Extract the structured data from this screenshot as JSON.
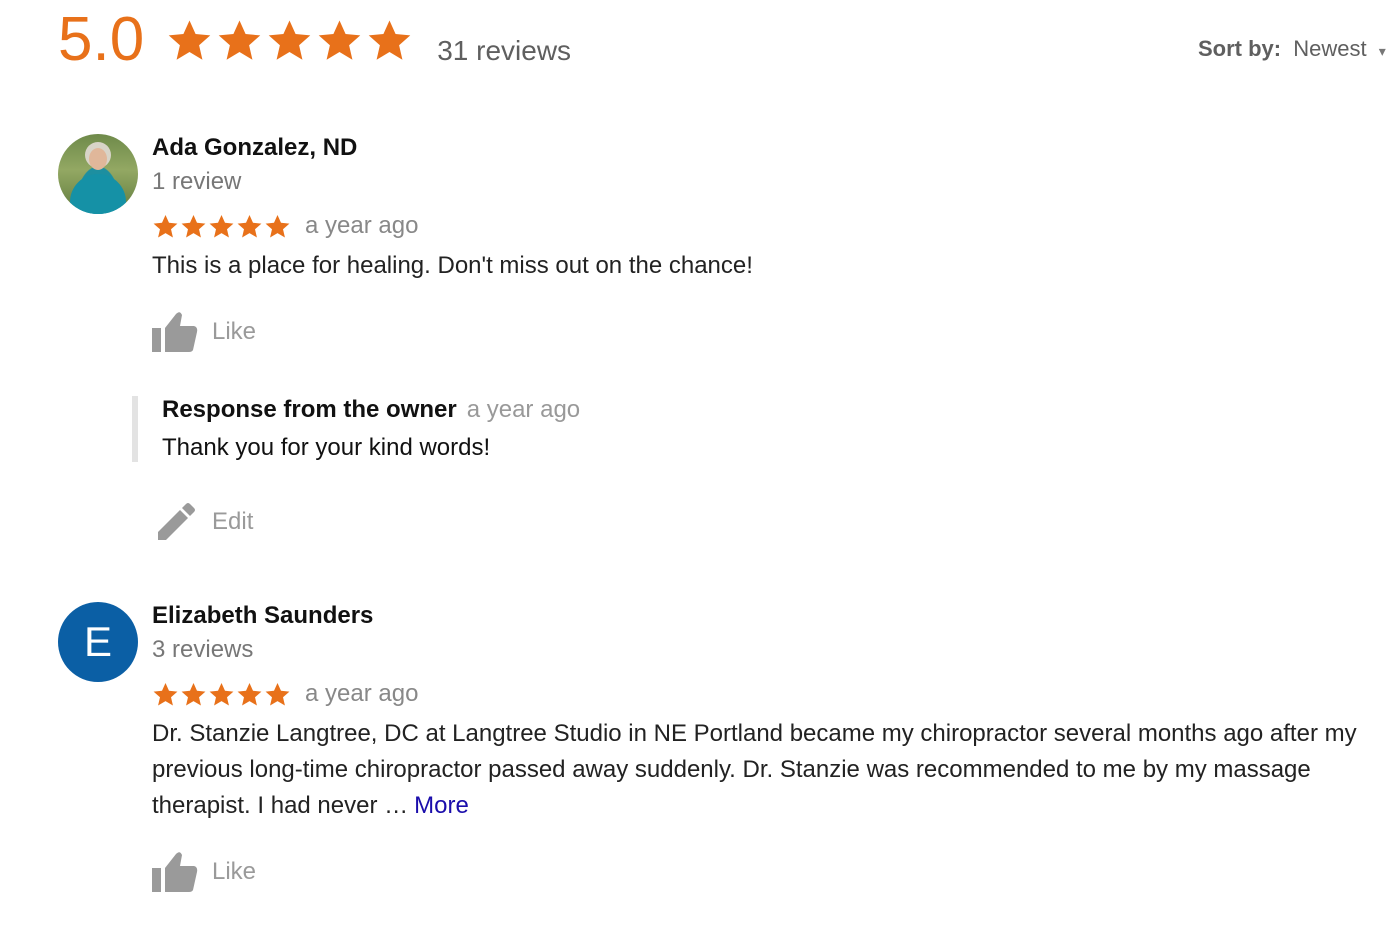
{
  "summary": {
    "score": "5.0",
    "rating": 5,
    "review_count": "31 reviews",
    "star_color": "#e8711a"
  },
  "sort": {
    "label": "Sort by:",
    "value": "Newest"
  },
  "reviews": [
    {
      "name": "Ada Gonzalez, ND",
      "review_count": "1 review",
      "rating": 5,
      "time": "a year ago",
      "text": "This is a place for healing. Don't miss out on the chance!",
      "like_label": "Like",
      "owner_response": {
        "title": "Response from the owner",
        "time": "a year ago",
        "text": "Thank you for your kind words!",
        "edit_label": "Edit"
      }
    },
    {
      "name": "Elizabeth Saunders",
      "avatar_letter": "E",
      "avatar_color": "#0b5fa5",
      "review_count": "3 reviews",
      "rating": 5,
      "time": "a year ago",
      "text": "Dr. Stanzie Langtree, DC at Langtree Studio in NE Portland became my chiropractor several months ago after my previous long-time chiropractor passed away suddenly. Dr. Stanzie was recommended to me by my massage therapist. I had never …",
      "more_label": "More",
      "like_label": "Like"
    }
  ],
  "icons": {
    "star": "star-icon",
    "like": "thumbs-up-icon",
    "edit": "pencil-icon",
    "sort": "chevron-down-icon"
  }
}
